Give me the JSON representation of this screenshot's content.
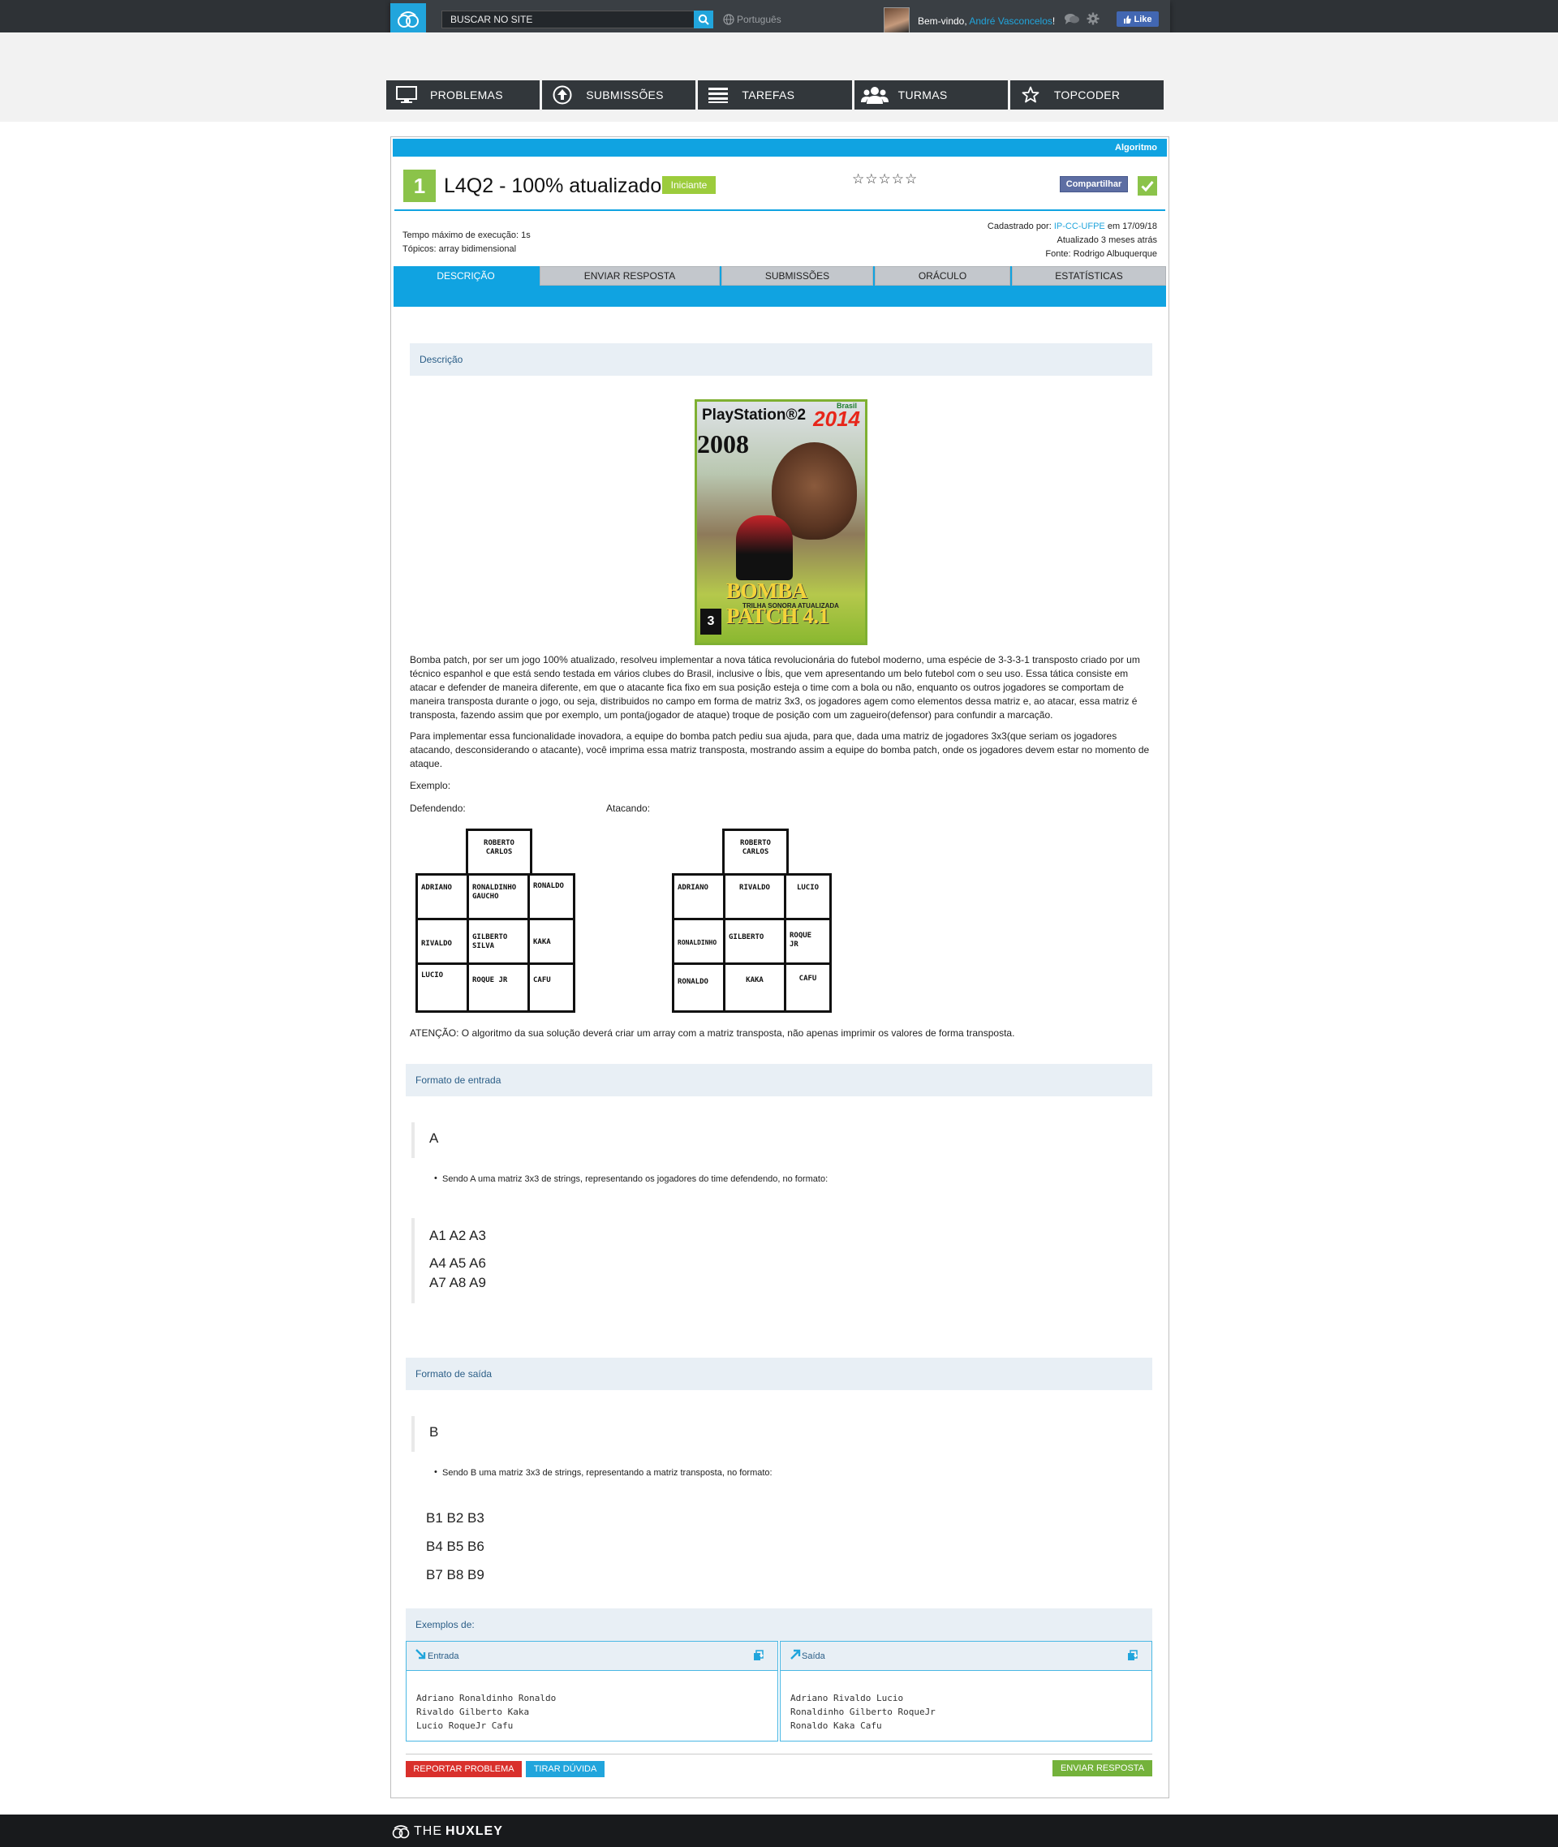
{
  "header": {
    "search_placeholder": "BUSCAR NO SITE",
    "language": "Português",
    "welcome_prefix": "Bem-vindo, ",
    "user_name": "André Vasconcelos",
    "welcome_suffix": "!",
    "like_label": "Like"
  },
  "nav": [
    {
      "label": "PROBLEMAS",
      "icon": "monitor-icon"
    },
    {
      "label": "SUBMISSÕES",
      "icon": "upload-icon"
    },
    {
      "label": "TAREFAS",
      "icon": "list-icon"
    },
    {
      "label": "TURMAS",
      "icon": "group-icon"
    },
    {
      "label": "TOPCODER",
      "icon": "star-icon"
    }
  ],
  "problem": {
    "category": "Algoritmo",
    "level": "1",
    "title": "L4Q2 - 100% atualizado",
    "difficulty": "Iniciante",
    "stars": "☆☆☆☆☆",
    "share_label": "Compartilhar",
    "time_limit": "Tempo máximo de execução: 1s",
    "topics": "Tópicos: array bidimensional",
    "registered_prefix": "Cadastrado por: ",
    "registered_by": "IP-CC-UFPE",
    "registered_suffix": " em 17/09/18",
    "updated": "Atualizado 3 meses atrás",
    "source": "Fonte: Rodrigo Albuquerque"
  },
  "tabs": [
    {
      "label": "DESCRIÇÃO",
      "active": true
    },
    {
      "label": "ENVIAR RESPOSTA",
      "active": false
    },
    {
      "label": "SUBMISSÕES",
      "active": false
    },
    {
      "label": "ORÁCULO",
      "active": false
    },
    {
      "label": "ESTATÍSTICAS",
      "active": false
    }
  ],
  "description": {
    "heading": "Descrição",
    "cover": {
      "ps2": "PlayStation®2",
      "brasil": "Brasil",
      "year_top": "2014",
      "year": "2008",
      "title": "BOMBA PATCH 4.1",
      "subtitle": "TRILHA SONORA ATUALIZADA",
      "rating": "3"
    },
    "p1": "Bomba patch, por ser um jogo 100% atualizado, resolveu implementar a nova tática revolucionária do futebol moderno, uma espécie de 3-3-3-1 transposto criado por um técnico espanhol e que está sendo testada em vários clubes do Brasil, inclusive o Íbis, que vem apresentando um belo futebol com o seu uso. Essa tática consiste em atacar e defender de maneira diferente, em que o atacante fica fixo em sua posição esteja o time com a bola ou não, enquanto os outros jogadores se comportam de maneira transposta durante o jogo, ou seja, distribuidos no campo em forma de matriz 3x3, os jogadores agem como elementos dessa matriz e, ao atacar, essa matriz é transposta, fazendo assim que por exemplo, um ponta(jogador de ataque) troque de posição com um zagueiro(defensor) para confundir a marcação.",
    "p2": "Para implementar essa funcionalidade inovadora, a equipe do bomba patch pediu sua ajuda, para que, dada uma matriz de jogadores 3x3(que seriam os jogadores atacando, desconsiderando o atacante), você imprima essa matriz transposta, mostrando assim a equipe do bomba patch, onde os jogadores devem estar no momento de ataque.",
    "example_label": "Exemplo:",
    "defending_label": "Defendendo:",
    "attacking_label": "Atacando:",
    "defending": {
      "top": "ROBERTO\nCARLOS",
      "rows": [
        [
          "ADRIANO",
          "RONALDINHO\nGAUCHO",
          "RONALDO"
        ],
        [
          "RIVALDO",
          "GILBERTO\nSILVA",
          "KAKA"
        ],
        [
          "LUCIO",
          "ROQUE JR",
          "CAFU"
        ]
      ]
    },
    "attacking": {
      "top": "ROBERTO\nCARLOS",
      "rows": [
        [
          "ADRIANO",
          "RIVALDO",
          "LUCIO"
        ],
        [
          "RONALDINHO",
          "GILBERTO",
          "ROQUE\nJR"
        ],
        [
          "RONALDO",
          "KAKA",
          "CAFU"
        ]
      ]
    },
    "attention": "ATENÇÃO: O algoritmo da sua solução deverá criar um array com a matriz transposta, não apenas imprimir os valores de forma transposta."
  },
  "input_format": {
    "heading": "Formato de entrada",
    "var": "A",
    "bullet": "Sendo A uma matriz 3x3 de strings, representando os jogadores do time defendendo, no formato:",
    "rows": [
      "A1 A2 A3",
      "A4 A5 A6",
      "A7 A8 A9"
    ]
  },
  "output_format": {
    "heading": "Formato de saída",
    "var": "B",
    "bullet": "Sendo B uma matriz 3x3 de strings, representando a matriz transposta, no formato:",
    "rows": [
      "B1 B2 B3",
      "B4 B5 B6",
      "B7 B8 B9"
    ]
  },
  "examples": {
    "heading": "Exemplos de:",
    "input_label": "Entrada",
    "output_label": "Saída",
    "input_lines": [
      "Adriano Ronaldinho Ronaldo",
      "Rivaldo Gilberto Kaka",
      "Lucio RoqueJr Cafu"
    ],
    "output_lines": [
      "Adriano Rivaldo Lucio",
      "Ronaldinho Gilberto RoqueJr",
      "Ronaldo Kaka Cafu"
    ]
  },
  "actions": {
    "report": "REPORTAR PROBLEMA",
    "ask": "TIRAR DÚVIDA",
    "submit": "ENVIAR RESPOSTA"
  },
  "footer": {
    "brand_the": "THE",
    "brand_huxley": "HUXLEY"
  },
  "colors": {
    "accent": "#10a3e1",
    "nav_bg": "#32373b",
    "level_green": "#8bc34a"
  }
}
